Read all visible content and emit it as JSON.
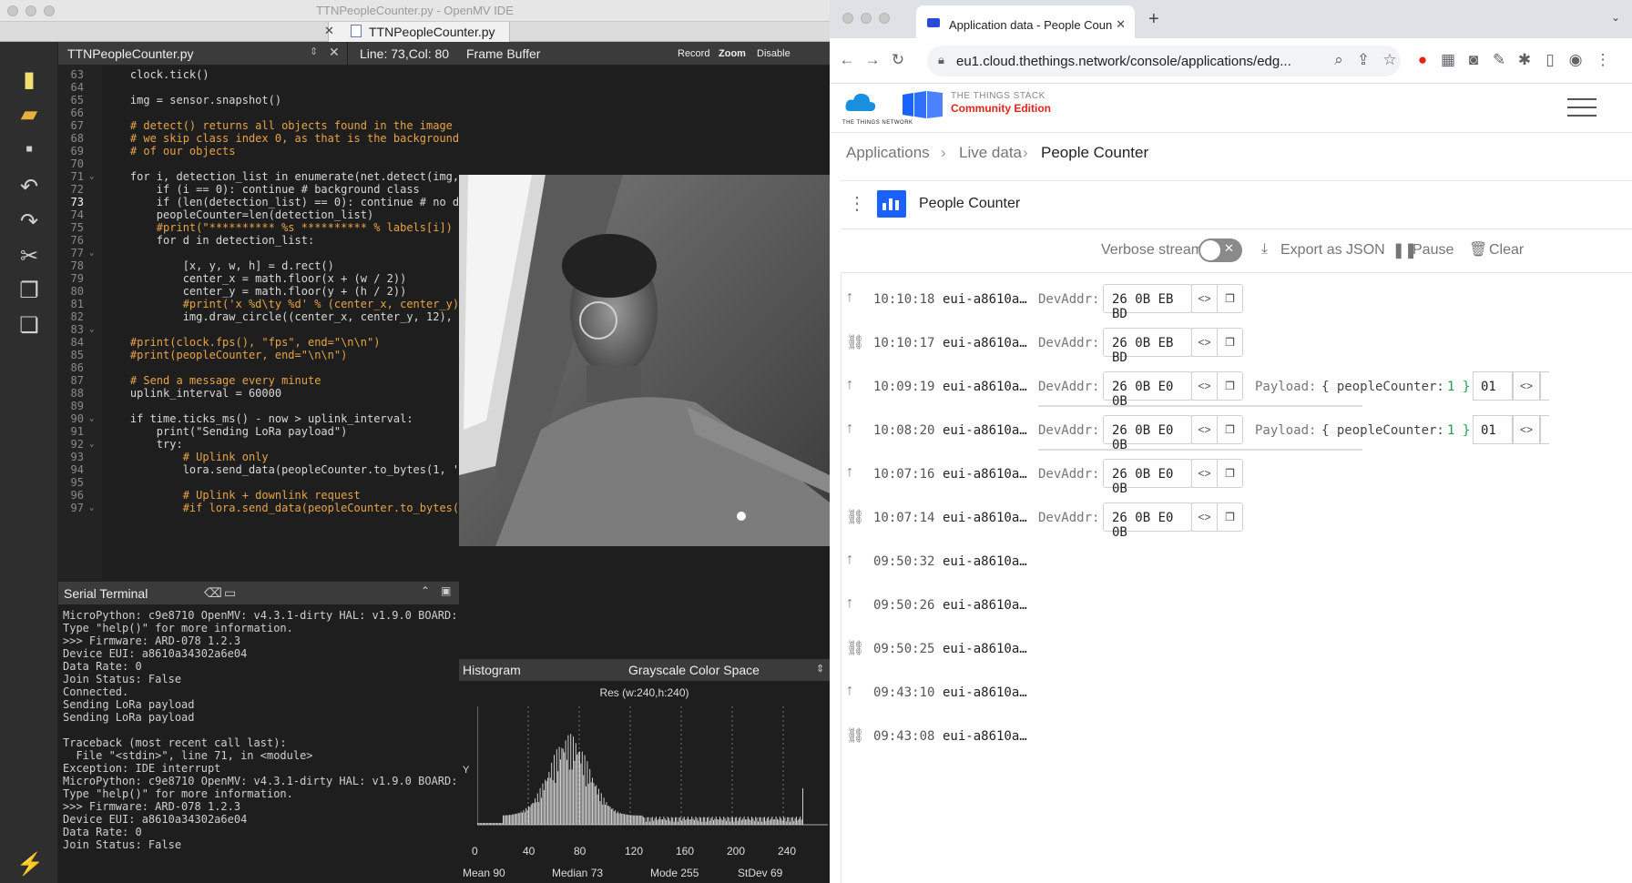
{
  "ide": {
    "window_title": "TTNPeopleCounter.py - OpenMV IDE",
    "file_tab": "TTNPeopleCounter.py",
    "editor_file": "TTNPeopleCounter.py",
    "cursor_pos": "Line: 73,Col: 80",
    "frame_buffer_title": "Frame Buffer",
    "record_label": "Record",
    "zoom_label": "Zoom",
    "disable_label": "Disable",
    "code_lines": [
      {
        "n": "63",
        "t": "    clock.tick()"
      },
      {
        "n": "64",
        "t": ""
      },
      {
        "n": "65",
        "t": "    img = sensor.snapshot()"
      },
      {
        "n": "66",
        "t": ""
      },
      {
        "n": "67",
        "t": "    # detect() returns all objects found in the image"
      },
      {
        "n": "68",
        "t": "    # we skip class index 0, as that is the background"
      },
      {
        "n": "69",
        "t": "    # of our objects"
      },
      {
        "n": "70",
        "t": ""
      },
      {
        "n": "71",
        "t": "    for i, detection_list in enumerate(net.detect(img,"
      },
      {
        "n": "72",
        "t": "        if (i == 0): continue # background class"
      },
      {
        "n": "73",
        "t": "        if (len(detection_list) == 0): continue # no d"
      },
      {
        "n": "74",
        "t": "        peopleCounter=len(detection_list)"
      },
      {
        "n": "75",
        "t": "        #print(\"********** %s ********** % labels[i])"
      },
      {
        "n": "76",
        "t": "        for d in detection_list:"
      },
      {
        "n": "77",
        "t": ""
      },
      {
        "n": "78",
        "t": "            [x, y, w, h] = d.rect()"
      },
      {
        "n": "79",
        "t": "            center_x = math.floor(x + (w / 2))"
      },
      {
        "n": "80",
        "t": "            center_y = math.floor(y + (h / 2))"
      },
      {
        "n": "81",
        "t": "            #print('x %d\\ty %d' % (center_x, center_y)"
      },
      {
        "n": "82",
        "t": "            img.draw_circle((center_x, center_y, 12),"
      },
      {
        "n": "83",
        "t": ""
      },
      {
        "n": "84",
        "t": "    #print(clock.fps(), \"fps\", end=\"\\n\\n\")"
      },
      {
        "n": "85",
        "t": "    #print(peopleCounter, end=\"\\n\\n\")"
      },
      {
        "n": "86",
        "t": ""
      },
      {
        "n": "87",
        "t": "    # Send a message every minute"
      },
      {
        "n": "88",
        "t": "    uplink_interval = 60000"
      },
      {
        "n": "89",
        "t": ""
      },
      {
        "n": "90",
        "t": "    if time.ticks_ms() - now > uplink_interval:"
      },
      {
        "n": "91",
        "t": "        print(\"Sending LoRa payload\")"
      },
      {
        "n": "92",
        "t": "        try:"
      },
      {
        "n": "93",
        "t": "            # Uplink only"
      },
      {
        "n": "94",
        "t": "            lora.send_data(peopleCounter.to_bytes(1, '"
      },
      {
        "n": "95",
        "t": ""
      },
      {
        "n": "96",
        "t": "            # Uplink + downlink request"
      },
      {
        "n": "97",
        "t": "            #if lora.send_data(peopleCounter.to_bytes("
      }
    ],
    "serial_terminal_title": "Serial Terminal",
    "terminal_lines": [
      "MicroPython: c9e8710 OpenMV: v4.3.1-dirty HAL: v1.9.0 BOARD:",
      "Type \"help()\" for more information.",
      ">>> Firmware: ARD-078 1.2.3",
      "Device EUI: a8610a34302a6e04",
      "Data Rate: 0",
      "Join Status: False",
      "Connected.",
      "Sending LoRa payload",
      "Sending LoRa payload",
      "",
      "Traceback (most recent call last):",
      "  File \"<stdin>\", line 71, in <module>",
      "Exception: IDE interrupt",
      "MicroPython: c9e8710 OpenMV: v4.3.1-dirty HAL: v1.9.0 BOARD:",
      "Type \"help()\" for more information.",
      ">>> Firmware: ARD-078 1.2.3",
      "Device EUI: a8610a34302a6e04",
      "Data Rate: 0",
      "Join Status: False"
    ],
    "histogram_title": "Histogram",
    "color_space": "Grayscale Color Space",
    "histogram_res": "Res (w:240,h:240)",
    "histogram_axis_label": "Y",
    "histogram_ticks": [
      "0",
      "40",
      "80",
      "120",
      "160",
      "200",
      "240"
    ],
    "stats": {
      "mean": "Mean 90",
      "median": "Median 73",
      "mode": "Mode 255",
      "stdev": "StDev 69"
    }
  },
  "browser": {
    "tab_title": "Application data - People Coun",
    "url": "eu1.cloud.thethings.network/console/applications/edg...",
    "brand_line1": "THE THINGS STACK",
    "brand_line2": "Community Edition",
    "logo_text": "THE THINGS NETWORK",
    "breadcrumbs": [
      "Applications",
      "Live data",
      "People Counter"
    ],
    "app_name": "People Counter",
    "verbose_label": "Verbose stream",
    "export_label": "Export as JSON",
    "pause_label": "Pause",
    "clear_label": "Clear",
    "devaddr_label": "DevAddr:",
    "payload_label": "Payload:",
    "events": [
      {
        "type": "uplink",
        "time": "10:10:18",
        "device": "eui-a8610a…",
        "addr": "26 0B EB BD",
        "payload": null
      },
      {
        "type": "join",
        "time": "10:10:17",
        "device": "eui-a8610a…",
        "addr": "26 0B EB BD",
        "payload": null
      },
      {
        "type": "uplink",
        "time": "10:09:19",
        "device": "eui-a8610a…",
        "addr": "26 0B E0 0B",
        "payload": {
          "text": "{ peopleCounter:",
          "num": "1 }",
          "hex": "01"
        }
      },
      {
        "type": "uplink",
        "time": "10:08:20",
        "device": "eui-a8610a…",
        "addr": "26 0B E0 0B",
        "payload": {
          "text": "{ peopleCounter:",
          "num": "1 }",
          "hex": "01"
        }
      },
      {
        "type": "uplink",
        "time": "10:07:16",
        "device": "eui-a8610a…",
        "addr": "26 0B E0 0B",
        "payload": null
      },
      {
        "type": "join",
        "time": "10:07:14",
        "device": "eui-a8610a…",
        "addr": "26 0B E0 0B",
        "payload": null
      },
      {
        "type": "uplink",
        "time": "09:50:32",
        "device": "eui-a8610a…",
        "addr": null,
        "payload": null
      },
      {
        "type": "uplink",
        "time": "09:50:26",
        "device": "eui-a8610a…",
        "addr": null,
        "payload": null
      },
      {
        "type": "join",
        "time": "09:50:25",
        "device": "eui-a8610a…",
        "addr": null,
        "payload": null
      },
      {
        "type": "uplink",
        "time": "09:43:10",
        "device": "eui-a8610a…",
        "addr": null,
        "payload": null
      },
      {
        "type": "join",
        "time": "09:43:08",
        "device": "eui-a8610a…",
        "addr": null,
        "payload": null
      }
    ]
  },
  "colors": {
    "ide_bg": "#1e1e1e",
    "ttn_red": "#e2231a",
    "ttn_blue": "#1a62ff",
    "payload_green": "#1f9d55"
  },
  "icons": {
    "uplink": "arrow-up-icon",
    "join": "link-icon"
  }
}
